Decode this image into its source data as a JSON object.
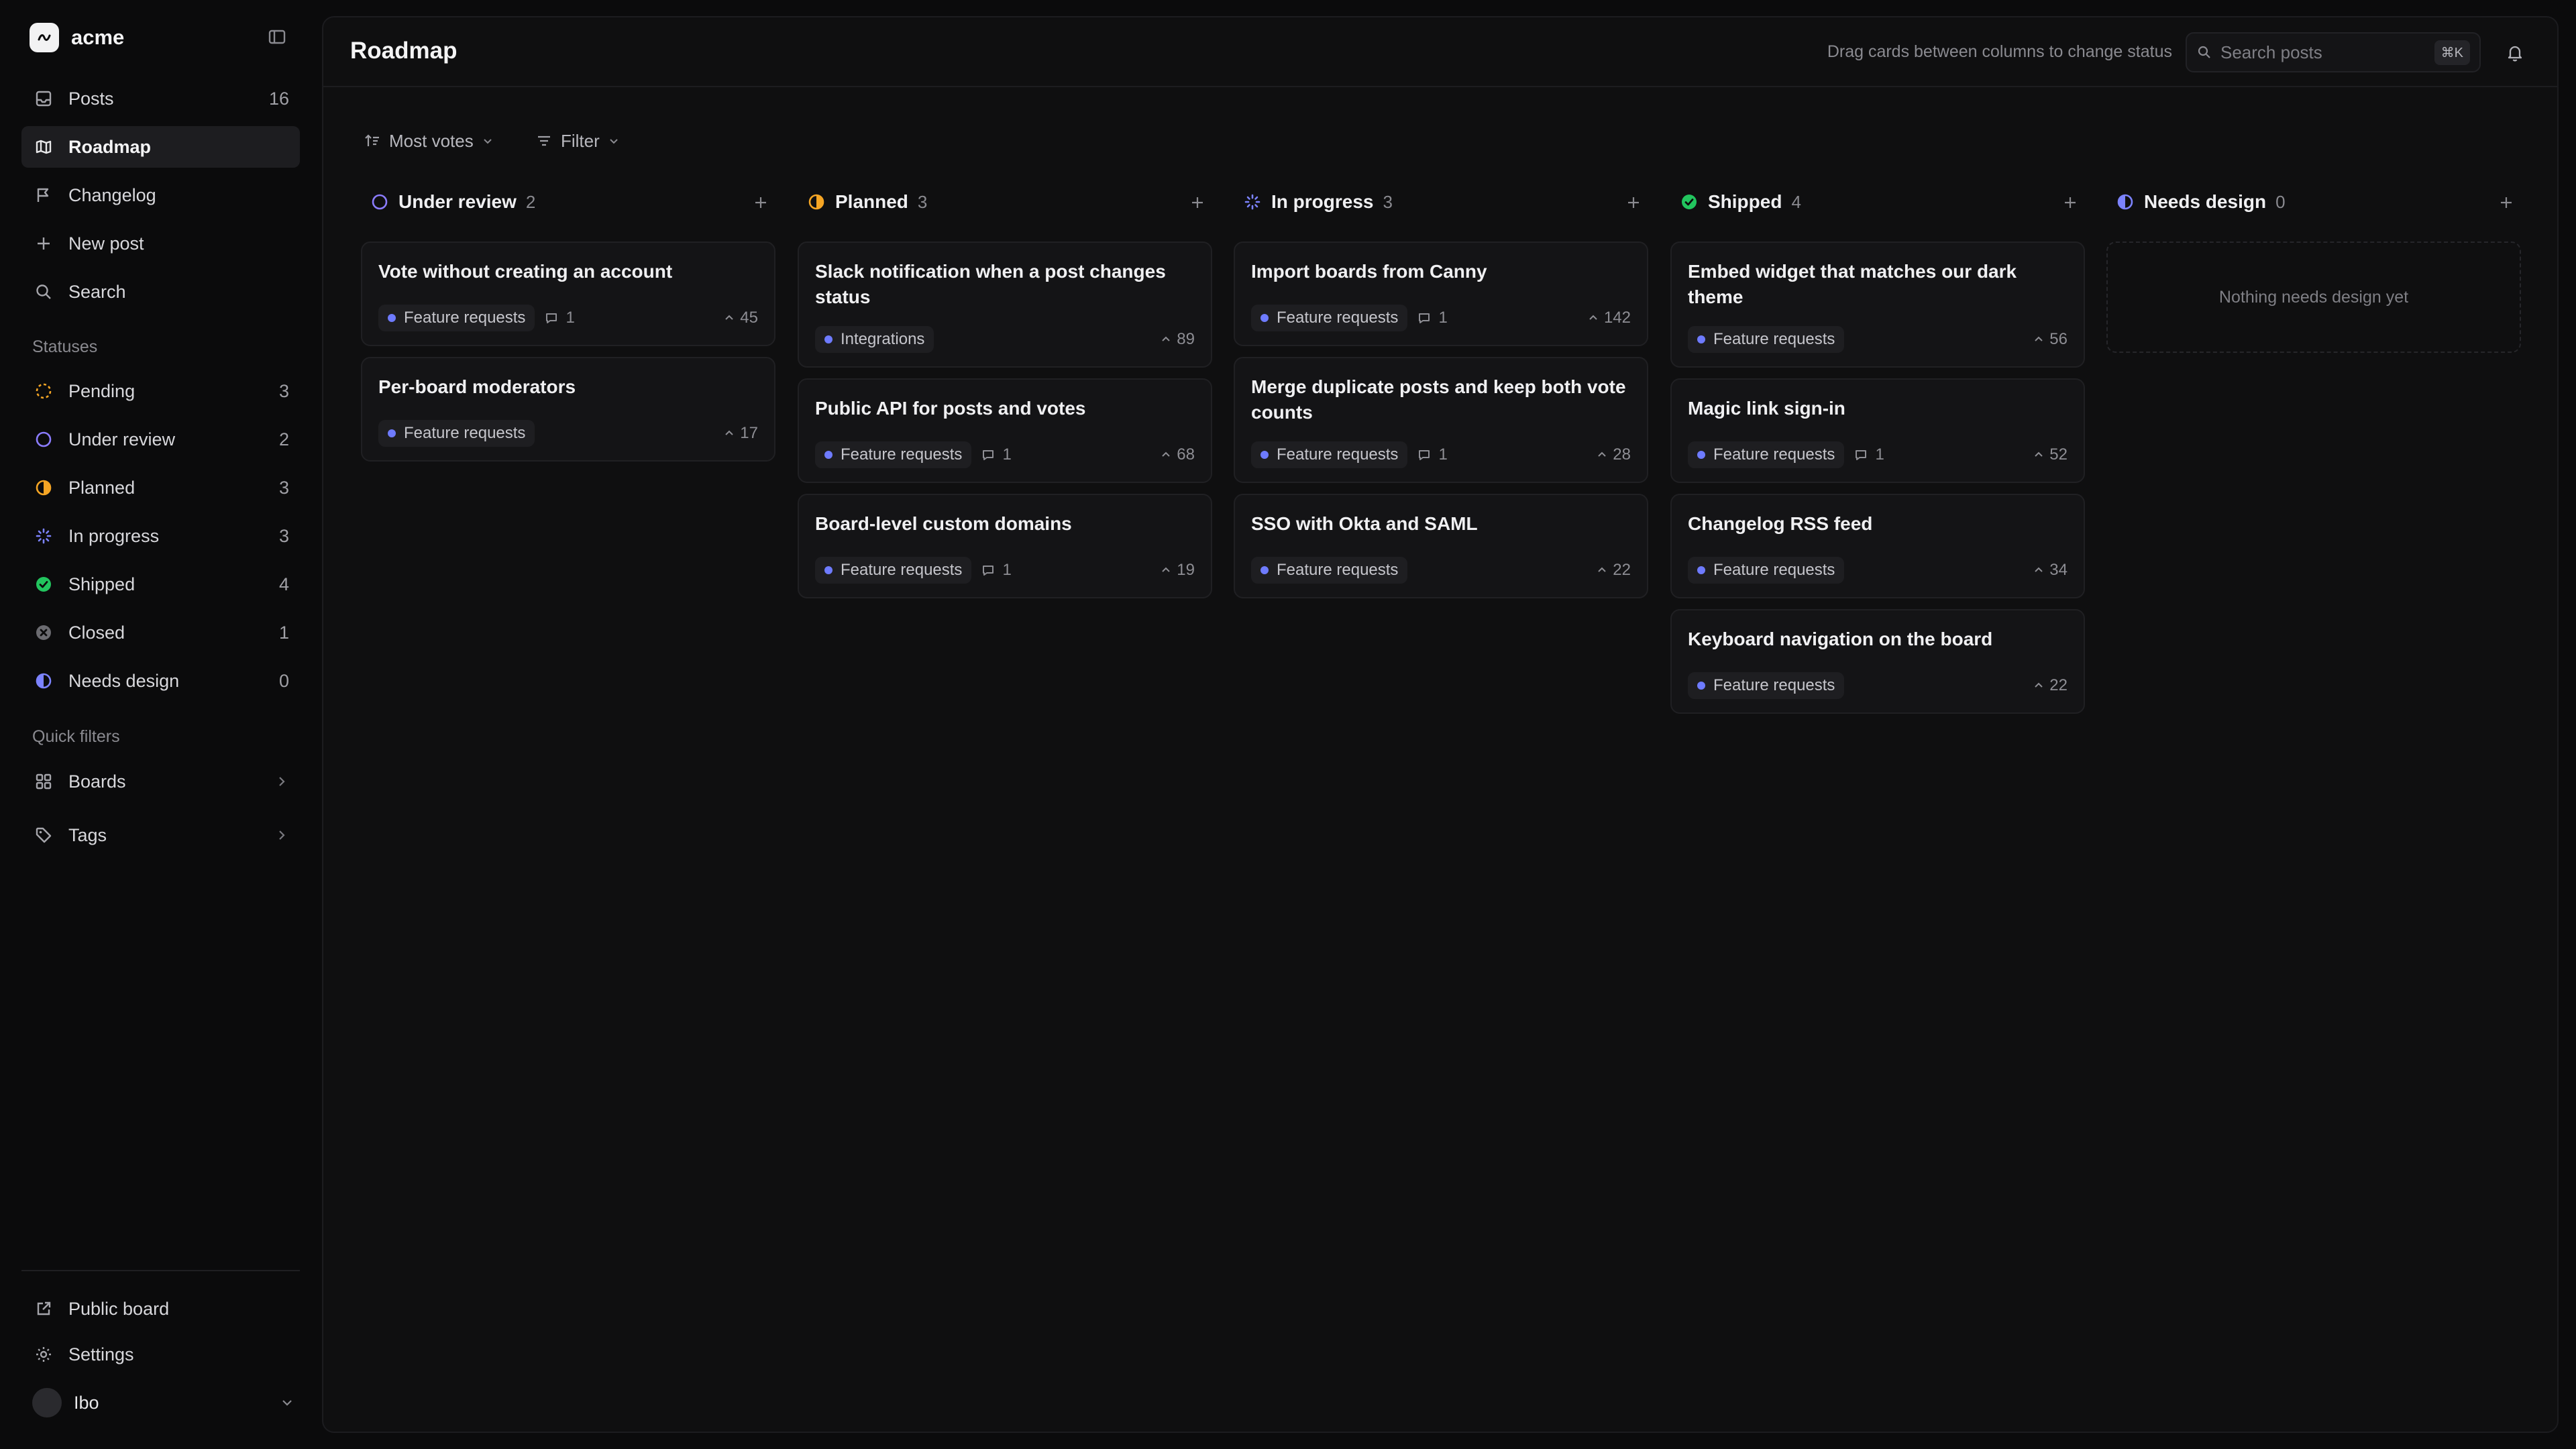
{
  "brand": {
    "name": "acme"
  },
  "nav": {
    "posts": {
      "label": "Posts",
      "count": "16"
    },
    "roadmap": {
      "label": "Roadmap"
    },
    "changelog": {
      "label": "Changelog"
    },
    "new_post": {
      "label": "New post"
    },
    "search": {
      "label": "Search"
    }
  },
  "statuses": {
    "label": "Statuses",
    "items": [
      {
        "label": "Pending",
        "count": "3",
        "color": "#f5a524"
      },
      {
        "label": "Under review",
        "count": "2",
        "color": "#8b7cff"
      },
      {
        "label": "Planned",
        "count": "3",
        "color": "#f5a524"
      },
      {
        "label": "In progress",
        "count": "3",
        "color": "#7c83ff"
      },
      {
        "label": "Shipped",
        "count": "4",
        "color": "#22c55e"
      },
      {
        "label": "Closed",
        "count": "1",
        "color": "#6b6b70"
      },
      {
        "label": "Needs design",
        "count": "0",
        "color": "#7c83ff"
      }
    ]
  },
  "quick_filters": {
    "label": "Quick filters",
    "boards": "Boards",
    "tags": "Tags"
  },
  "footer": {
    "public_board": "Public board",
    "settings": "Settings",
    "user_name": "Ibo"
  },
  "header": {
    "title": "Roadmap",
    "hint": "Drag cards between columns to change status",
    "search_placeholder": "Search posts",
    "search_shortcut": "⌘K"
  },
  "toolbar": {
    "sort_label": "Most votes",
    "filter_label": "Filter"
  },
  "columns": [
    {
      "title": "Under review",
      "count": "2",
      "cards": [
        {
          "title": "Vote without creating an account",
          "tag": "Feature requests",
          "comments": "1",
          "votes": "45"
        },
        {
          "title": "Per-board moderators",
          "tag": "Feature requests",
          "comments": "",
          "votes": "17"
        }
      ]
    },
    {
      "title": "Planned",
      "count": "3",
      "cards": [
        {
          "title": "Slack notification when a post changes status",
          "tag": "Integrations",
          "comments": "",
          "votes": "89"
        },
        {
          "title": "Public API for posts and votes",
          "tag": "Feature requests",
          "comments": "1",
          "votes": "68"
        },
        {
          "title": "Board-level custom domains",
          "tag": "Feature requests",
          "comments": "1",
          "votes": "19"
        }
      ]
    },
    {
      "title": "In progress",
      "count": "3",
      "cards": [
        {
          "title": "Import boards from Canny",
          "tag": "Feature requests",
          "comments": "1",
          "votes": "142"
        },
        {
          "title": "Merge duplicate posts and keep both vote counts",
          "tag": "Feature requests",
          "comments": "1",
          "votes": "28"
        },
        {
          "title": "SSO with Okta and SAML",
          "tag": "Feature requests",
          "comments": "",
          "votes": "22"
        }
      ]
    },
    {
      "title": "Shipped",
      "count": "4",
      "cards": [
        {
          "title": "Embed widget that matches our dark theme",
          "tag": "Feature requests",
          "comments": "",
          "votes": "56"
        },
        {
          "title": "Magic link sign-in",
          "tag": "Feature requests",
          "comments": "1",
          "votes": "52"
        },
        {
          "title": "Changelog RSS feed",
          "tag": "Feature requests",
          "comments": "",
          "votes": "34"
        },
        {
          "title": "Keyboard navigation on the board",
          "tag": "Feature requests",
          "comments": "",
          "votes": "22"
        }
      ]
    },
    {
      "title": "Needs design",
      "count": "0",
      "empty_text": "Nothing needs design yet",
      "cards": []
    }
  ]
}
